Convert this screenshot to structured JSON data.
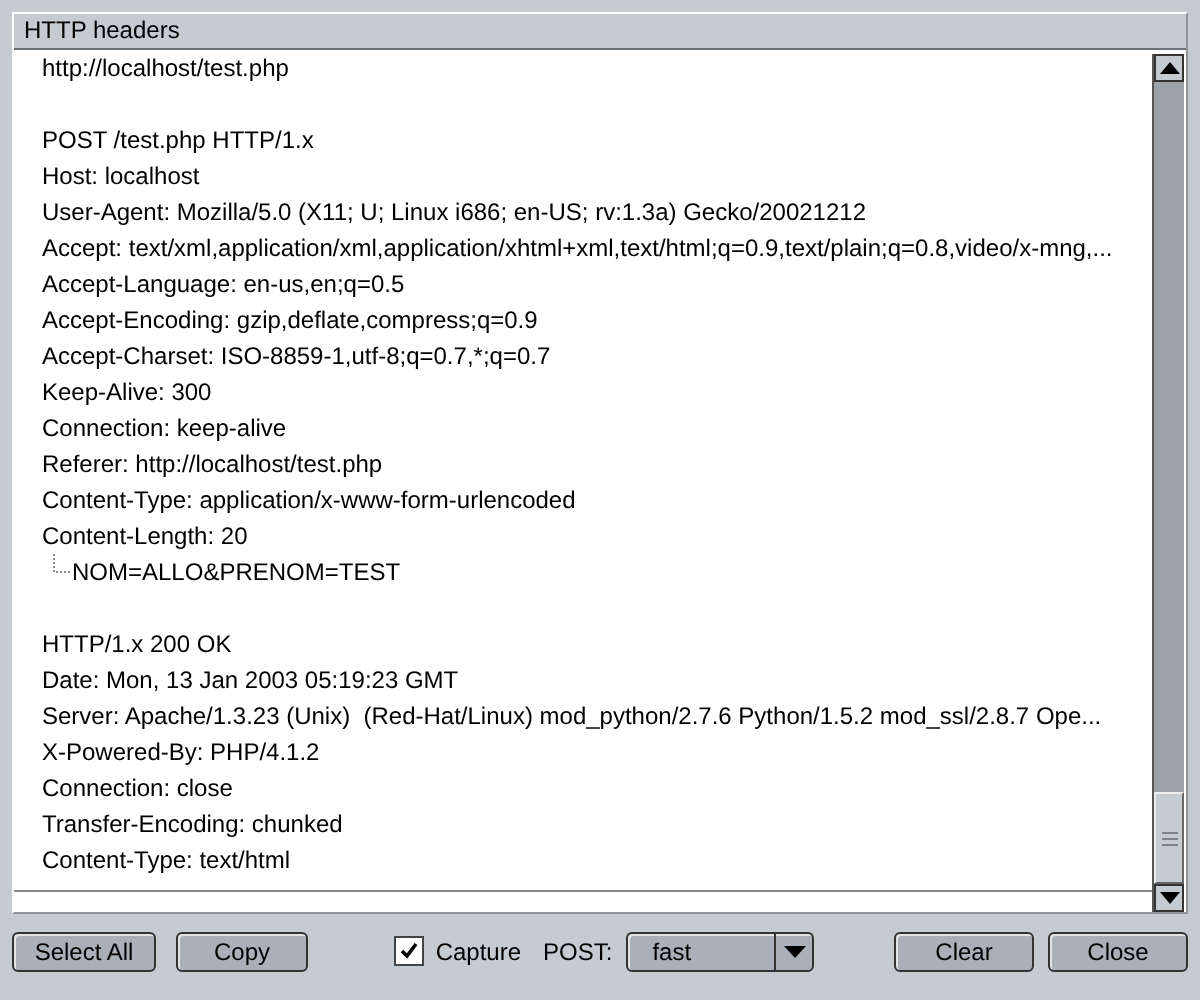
{
  "panel": {
    "title": "HTTP headers",
    "groups": [
      {
        "entries": [
          {
            "text": "http://localhost/test.php"
          }
        ]
      },
      {
        "entries": [
          {
            "text": "POST /test.php HTTP/1.x"
          },
          {
            "text": "Host: localhost"
          },
          {
            "text": "User-Agent: Mozilla/5.0 (X11; U; Linux i686; en-US; rv:1.3a) Gecko/20021212"
          },
          {
            "text": "Accept: text/xml,application/xml,application/xhtml+xml,text/html;q=0.9,text/plain;q=0.8,video/x-mng,..."
          },
          {
            "text": "Accept-Language: en-us,en;q=0.5"
          },
          {
            "text": "Accept-Encoding: gzip,deflate,compress;q=0.9"
          },
          {
            "text": "Accept-Charset: ISO-8859-1,utf-8;q=0.7,*;q=0.7"
          },
          {
            "text": "Keep-Alive: 300"
          },
          {
            "text": "Connection: keep-alive"
          },
          {
            "text": "Referer: http://localhost/test.php"
          },
          {
            "text": "Content-Type: application/x-www-form-urlencoded"
          },
          {
            "text": "Content-Length: 20",
            "children": [
              {
                "text": "NOM=ALLO&PRENOM=TEST"
              }
            ]
          }
        ]
      },
      {
        "entries": [
          {
            "text": "HTTP/1.x 200 OK"
          },
          {
            "text": "Date: Mon, 13 Jan 2003 05:19:23 GMT"
          },
          {
            "text": "Server: Apache/1.3.23 (Unix)  (Red-Hat/Linux) mod_python/2.7.6 Python/1.5.2 mod_ssl/2.8.7 Ope..."
          },
          {
            "text": "X-Powered-By: PHP/4.1.2"
          },
          {
            "text": "Connection: close"
          },
          {
            "text": "Transfer-Encoding: chunked"
          },
          {
            "text": "Content-Type: text/html"
          }
        ]
      }
    ]
  },
  "footer": {
    "select_all": "Select All",
    "copy": "Copy",
    "capture": {
      "label": "Capture",
      "checked": true
    },
    "post_label": "POST:",
    "post_mode": "fast",
    "clear": "Clear",
    "close": "Close"
  }
}
